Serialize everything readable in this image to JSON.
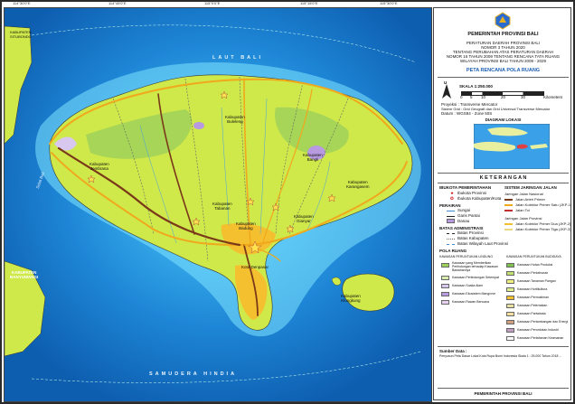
{
  "map": {
    "seas": {
      "north": "LAUT BALI",
      "south": "SAMUDERA HINDIA",
      "strait": "Selat Bali"
    },
    "labels": {
      "buleleng": "Kabupaten\nBuleleng",
      "jembrana": "Kabupaten\nJembrana",
      "tabanan": "Kabupaten\nTabanan",
      "bangli": "Kabupaten\nBangli",
      "karangasem": "Kabupaten\nKarangasem",
      "gianyar": "Kabupaten\nGianyar",
      "badung": "Kabupaten\nBadung",
      "klungkung": "Kabupaten\nKlungkung",
      "denpasar": "Kota Denpasar",
      "banyuwangi": "KABUPATEN\nBANYUWANGI",
      "situbondo": "KABUPATEN\nSITUBONDO"
    },
    "colors": {
      "sea": "#1e86d6",
      "land": "#cfe84a",
      "road": "#f0a81c",
      "toll": "#7a3a1a",
      "urban": "#f5c030",
      "forest": "#9bd05a"
    }
  },
  "legend": {
    "org": "PEMERINTAH PROVINSI BALI",
    "law1": "PERATURAN DAERAH PROVINSI BALI",
    "law2": "NOMOR 3 TAHUN 2020",
    "law3": "TENTANG PERUBAHAN ATAS PERATURAN DAERAH",
    "law4": "NOMOR 16 TAHUN 2009 TENTANG RENCANA TATA RUANG",
    "law5": "WILAYAH PROVINSI BALI TAHUN 2009 - 2029",
    "title": "PETA RENCANA POLA RUANG",
    "scale": "SKALA 1:250.000",
    "scale_ticks": [
      "0",
      "5",
      "10",
      "20",
      "30"
    ],
    "scale_unit": "Kilometers",
    "north": "U",
    "projection": "Proyeksi : Transverse Mercator",
    "grid": "Sistem Grid : Grid Geografi dan Grid Universal Transverse Mercator",
    "datum": "Datum : WGS84 - Zone 50S",
    "location_title": "DIAGRAM LOKASI",
    "keterangan": "K E T E R A N G A N",
    "ibukota_title": "IBUKOTA PEMERINTAHAN",
    "ibukota": [
      "Ibukota Provinsi",
      "Ibukota Kabupaten/Kota"
    ],
    "perairan_title": "PERAIRAN",
    "perairan": [
      "Sungai",
      "Garis Pantai",
      "Danau"
    ],
    "batas_title": "BATAS ADMINISTRASI",
    "batas": [
      "Batas Provinsi",
      "Batas Kabupaten",
      "Batas Wilayah Laut Provinsi"
    ],
    "jaringan_title": "SISTEM JARINGAN JALAN",
    "jaringan": [
      "Jaringan Jalan Nasional",
      "Jalan Arteri Primer",
      "Jalan Kolektor Primer Satu (JKP-1)",
      "Jalan Tol",
      "Jaringan Jalan Provinsi",
      "Jalan Kolektor Primer Dua (JKP-2)",
      "Jalan Kolektor Primer Tiga (JKP-3)"
    ],
    "pola_title": "POLA RUANG",
    "lindung_title": "KAWASAN PERUNTUKAN LINDUNG",
    "budidaya_title": "KAWASAN PERUNTUKAN BUDIDAYA",
    "lindung": [
      "Kawasan yang Memberikan Perlindungan terhadap Kawasan Bawahannya",
      "Kawasan Perlindungan Setempat",
      "Kawasan Suaka Alam",
      "Kawasan Ekosistem Mangrove",
      "Kawasan Rawan Bencana"
    ],
    "budidaya": [
      "Kawasan Hutan Produksi",
      "Kawasan Perkebunan",
      "Kawasan Tanaman Pangan",
      "Kawasan Hortikultura",
      "Kawasan Permukiman",
      "Kawasan Peternakan",
      "Kawasan Pariwisata",
      "Kawasan Pertambangan dan Energi",
      "Kawasan Peruntukan Industri",
      "Kawasan Pertahanan Keamanan"
    ],
    "sumber_title": "Sumber Data :",
    "sumber": "Penyusun Peta Dasar Lokal Kota Rupa Bumi Indonesia Skala 1 : 25.000 Tahun 2018 ...",
    "footer": "PEMERINTAH PROVINSI BALI"
  }
}
